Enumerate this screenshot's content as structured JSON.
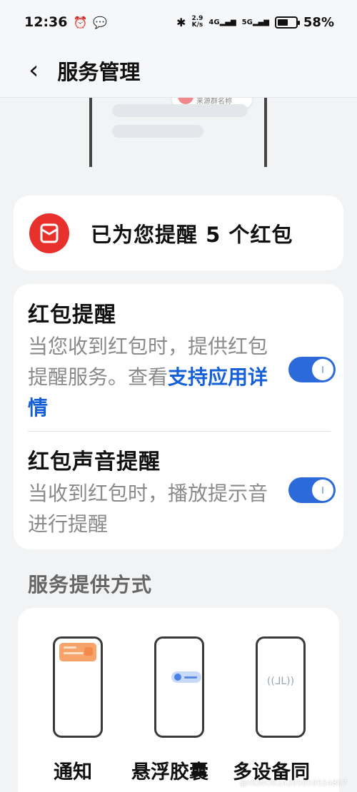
{
  "status_bar": {
    "time": "12:36",
    "net_speed_top": "2.9",
    "net_speed_bottom": "K/s",
    "sig1": "4G",
    "sig2": "5G",
    "battery_text": "58%",
    "battery_level": 0.58
  },
  "header": {
    "title": "服务管理"
  },
  "preview": {
    "bubble_text": "来源群名称"
  },
  "summary": {
    "text": "已为您提醒 5 个红包"
  },
  "settings": [
    {
      "title": "红包提醒",
      "desc": "当您收到红包时，提供红包提醒服务。查看",
      "link": "支持应用详情",
      "enabled": true
    },
    {
      "title": "红包声音提醒",
      "desc": "当收到红包时，播放提示音进行提醒",
      "enabled": true
    }
  ],
  "section_title": "服务提供方式",
  "methods": [
    {
      "label": "通知",
      "icon": "notification-preview-icon"
    },
    {
      "label": "悬浮胶囊",
      "icon": "floating-capsule-preview-icon"
    },
    {
      "label": "多设备同",
      "icon": "earbuds-preview-icon"
    }
  ],
  "watermark": "@HONOR24205059554807"
}
